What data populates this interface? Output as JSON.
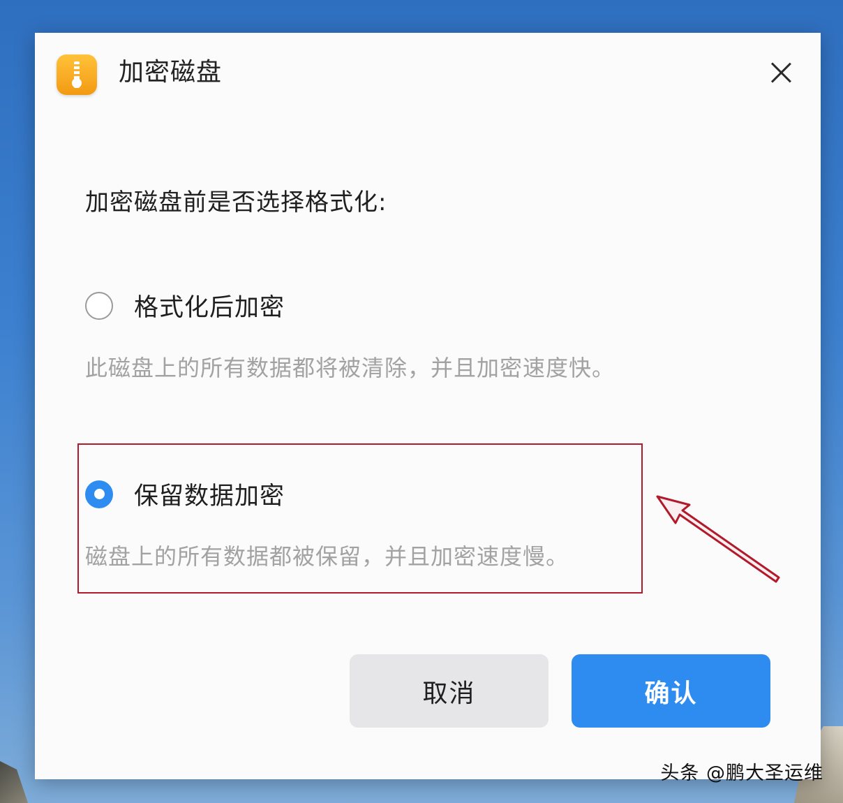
{
  "dialog": {
    "title": "加密磁盘",
    "question": "加密磁盘前是否选择格式化:",
    "options": [
      {
        "label": "格式化后加密",
        "description": "此磁盘上的所有数据都将被清除，并且加密速度快。",
        "selected": false
      },
      {
        "label": "保留数据加密",
        "description": "磁盘上的所有数据都被保留，并且加密速度慢。",
        "selected": true
      }
    ],
    "cancel_label": "取消",
    "confirm_label": "确认"
  },
  "icons": {
    "app": "zip-lock-icon",
    "close": "close-icon"
  },
  "colors": {
    "accent": "#2e8cf0",
    "highlight": "#b11a2b",
    "app_icon": "#f7a81f"
  },
  "watermark": "头条 @鹏大圣运维"
}
